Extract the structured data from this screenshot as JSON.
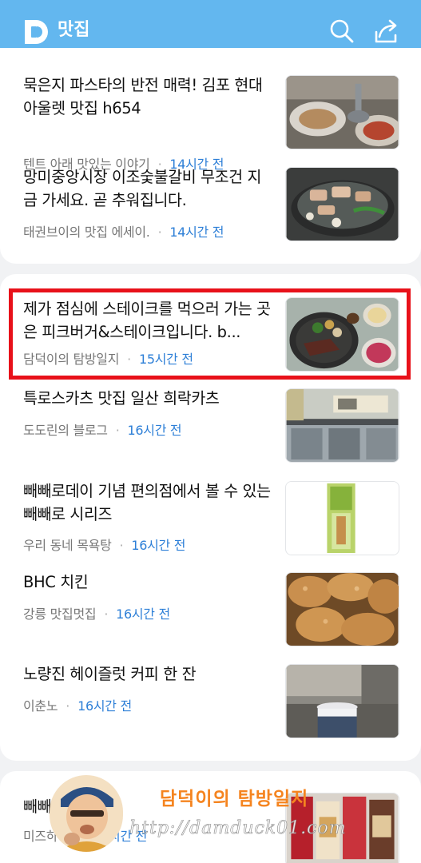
{
  "app": {
    "title": "맛집",
    "logo_letter": "D",
    "accent": "#63b7ef",
    "time_color": "#2d7fd7",
    "highlight_color": "#e8111a"
  },
  "icons": {
    "search": "search-icon",
    "share": "share-icon"
  },
  "feed": [
    {
      "title": "묵은지 파스타의 반전 매력! 김포 현대아울렛 맛집 h654",
      "source": "텐트 아래 맛있는 이야기",
      "time": "14시간 전"
    },
    {
      "title": "망미중앙시장 이조숯불갈비 무조건 지금 가세요. 곧 추워집니다.",
      "source": "태권브이의 맛집 에세이.",
      "time": "14시간 전"
    },
    {
      "title": "제가 점심에 스테이크를 먹으러 가는 곳은 피크버거&스테이크입니다. b...",
      "source": "담덕이의 탐방일지",
      "time": "15시간 전"
    },
    {
      "title": "특로스카츠 맛집 일산 희락카츠",
      "source": "도도린의 블로그",
      "time": "16시간 전"
    },
    {
      "title": "빼빼로데이 기념 편의점에서 볼 수 있는 빼빼로 시리즈",
      "source": "우리 동네 목욕탕",
      "time": "16시간 전"
    },
    {
      "title": "BHC 치킨",
      "source": "강릉 맛집멋집",
      "time": "16시간 전"
    },
    {
      "title": "노량진 헤이즐럿 커피 한 잔",
      "source": "이춘노",
      "time": "16시간 전"
    },
    {
      "title": "빼빼로데이 리",
      "source": "미즈하 숲",
      "time": "17시간 전"
    }
  ],
  "watermark": {
    "script": "담덕이의 탐방일지",
    "url": "http://damduck01.com"
  }
}
